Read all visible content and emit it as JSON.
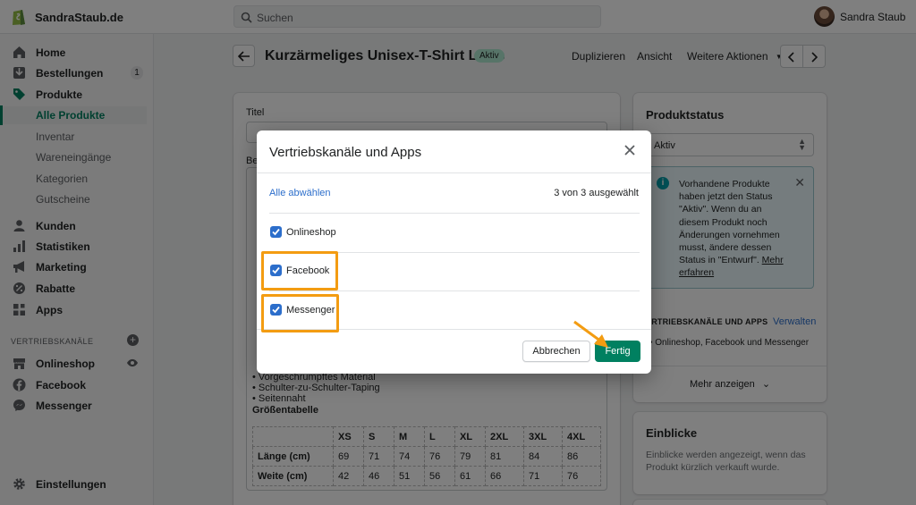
{
  "topbar": {
    "store_name": "SandraStaub.de",
    "search_placeholder": "Suchen",
    "user_name": "Sandra Staub"
  },
  "sidebar": {
    "items": [
      {
        "label": "Home",
        "icon": "home-icon"
      },
      {
        "label": "Bestellungen",
        "icon": "orders-icon",
        "count": "1"
      },
      {
        "label": "Produkte",
        "icon": "tag-icon"
      },
      {
        "label": "Alle Produkte"
      },
      {
        "label": "Inventar"
      },
      {
        "label": "Wareneingänge"
      },
      {
        "label": "Kategorien"
      },
      {
        "label": "Gutscheine"
      },
      {
        "label": "Kunden",
        "icon": "customers-icon"
      },
      {
        "label": "Statistiken",
        "icon": "analytics-icon"
      },
      {
        "label": "Marketing",
        "icon": "megaphone-icon"
      },
      {
        "label": "Rabatte",
        "icon": "discount-icon"
      },
      {
        "label": "Apps",
        "icon": "apps-icon"
      }
    ],
    "channels_label": "VERTRIEBSKANÄLE",
    "channels": [
      {
        "label": "Onlineshop",
        "icon": "store-icon"
      },
      {
        "label": "Facebook",
        "icon": "facebook-icon"
      },
      {
        "label": "Messenger",
        "icon": "messenger-icon"
      }
    ],
    "settings_label": "Einstellungen"
  },
  "page": {
    "title": "Kurzärmeliges Unisex-T-Shirt Likes",
    "status_badge": "Aktiv",
    "actions": {
      "duplicate": "Duplizieren",
      "view": "Ansicht",
      "more": "Weitere Aktionen"
    }
  },
  "main_card": {
    "title_label": "Titel",
    "description_label": "Be",
    "description_lines": [
      "• Vorgeschrumpftes Material",
      "• Schulter-zu-Schulter-Taping",
      "• Seitennaht"
    ],
    "size_table_heading": "Größentabelle",
    "size_table": {
      "headers": [
        "",
        "XS",
        "S",
        "M",
        "L",
        "XL",
        "2XL",
        "3XL",
        "4XL"
      ],
      "rows": [
        [
          "Länge (cm)",
          "69",
          "71",
          "74",
          "76",
          "79",
          "81",
          "84",
          "86"
        ],
        [
          "Weite (cm)",
          "42",
          "46",
          "51",
          "56",
          "61",
          "66",
          "71",
          "76"
        ]
      ]
    }
  },
  "status_card": {
    "heading": "Produktstatus",
    "selected_status": "Aktiv",
    "info_text": "Vorhandene Produkte haben jetzt den Status \"Aktiv\". Wenn du an diesem Produkt noch Änderungen vornehmen musst, ändere dessen Status in \"Entwurf\".",
    "info_link": "Mehr erfahren",
    "channels_heading": "ERTRIEBSKANÄLE UND APPS",
    "manage_link": "Verwalten",
    "channels_summary": "Onlineshop, Facebook und Messenger",
    "show_more": "Mehr anzeigen"
  },
  "insights_card": {
    "heading": "Einblicke",
    "text": "Einblicke werden angezeigt, wenn das Produkt kürzlich verkauft wurde."
  },
  "modal": {
    "title": "Vertriebskanäle und Apps",
    "deselect_all": "Alle abwählen",
    "selected_count": "3 von 3 ausgewählt",
    "channels": [
      {
        "label": "Onlineshop",
        "checked": true
      },
      {
        "label": "Facebook",
        "checked": true
      },
      {
        "label": "Messenger",
        "checked": true
      }
    ],
    "cancel": "Abbrechen",
    "done": "Fertig"
  },
  "colors": {
    "accent_green": "#008060",
    "link_blue": "#2c6ecb",
    "highlight_orange": "#f39c12"
  }
}
